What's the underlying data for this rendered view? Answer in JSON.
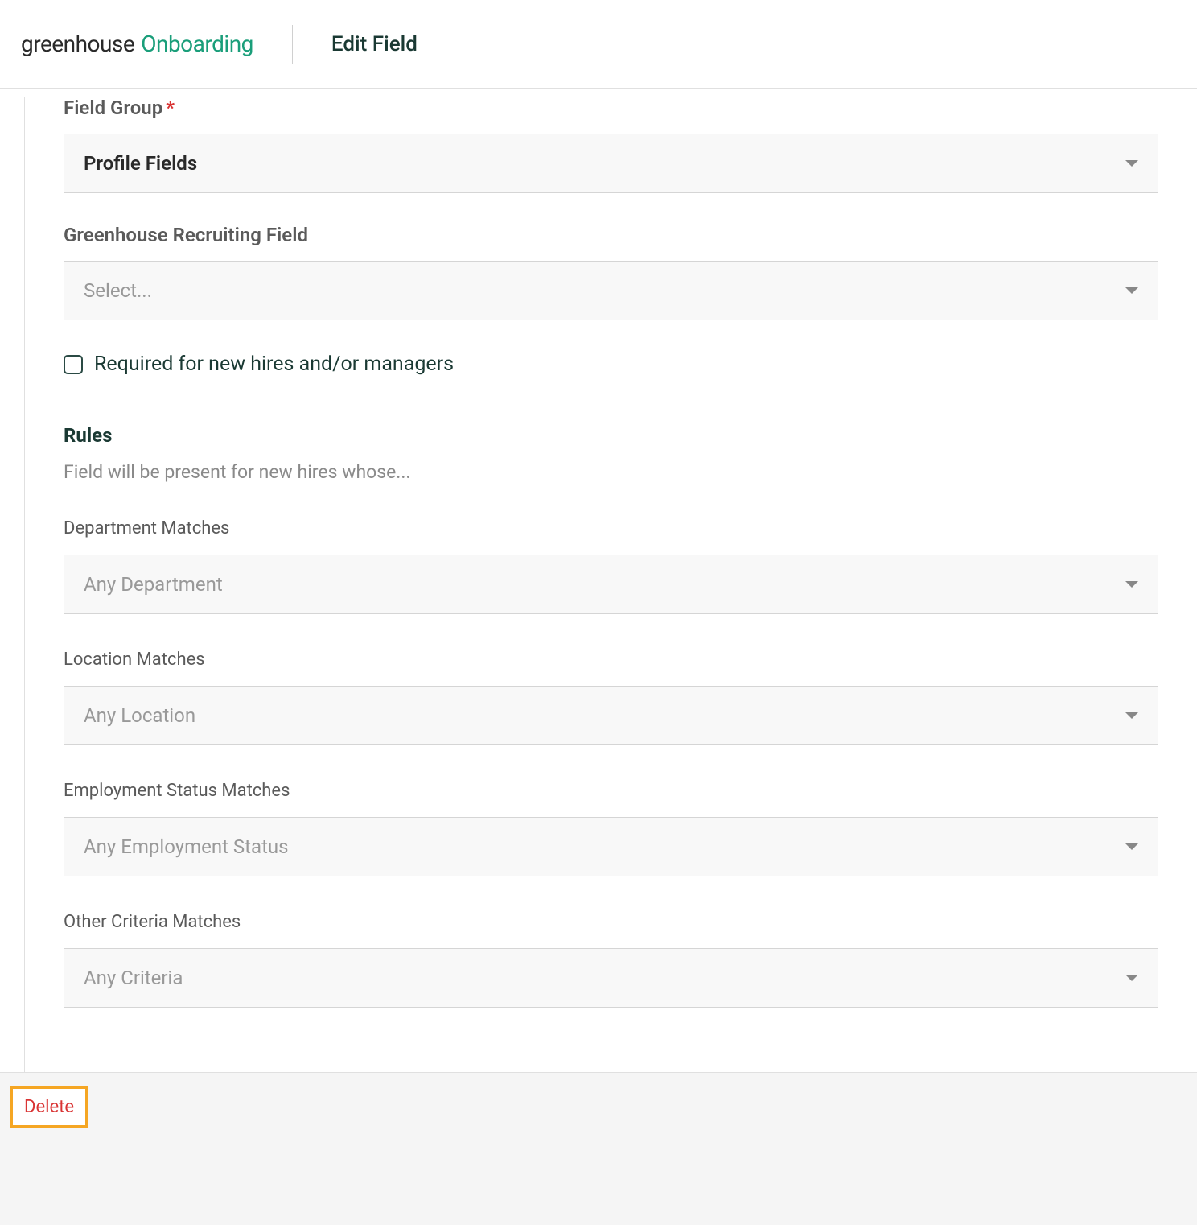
{
  "header": {
    "logo_primary": "greenhouse",
    "logo_secondary": "Onboarding",
    "page_title": "Edit Field"
  },
  "form": {
    "field_group": {
      "label": "Field Group",
      "required_marker": "*",
      "value": "Profile Fields"
    },
    "recruiting_field": {
      "label": "Greenhouse Recruiting Field",
      "placeholder": "Select..."
    },
    "required_checkbox": {
      "label": "Required for new hires and/or managers"
    },
    "rules": {
      "heading": "Rules",
      "subtext": "Field will be present for new hires whose...",
      "department": {
        "label": "Department Matches",
        "placeholder": "Any Department"
      },
      "location": {
        "label": "Location Matches",
        "placeholder": "Any Location"
      },
      "employment_status": {
        "label": "Employment Status Matches",
        "placeholder": "Any Employment Status"
      },
      "other_criteria": {
        "label": "Other Criteria Matches",
        "placeholder": "Any Criteria"
      }
    }
  },
  "footer": {
    "delete_label": "Delete"
  }
}
